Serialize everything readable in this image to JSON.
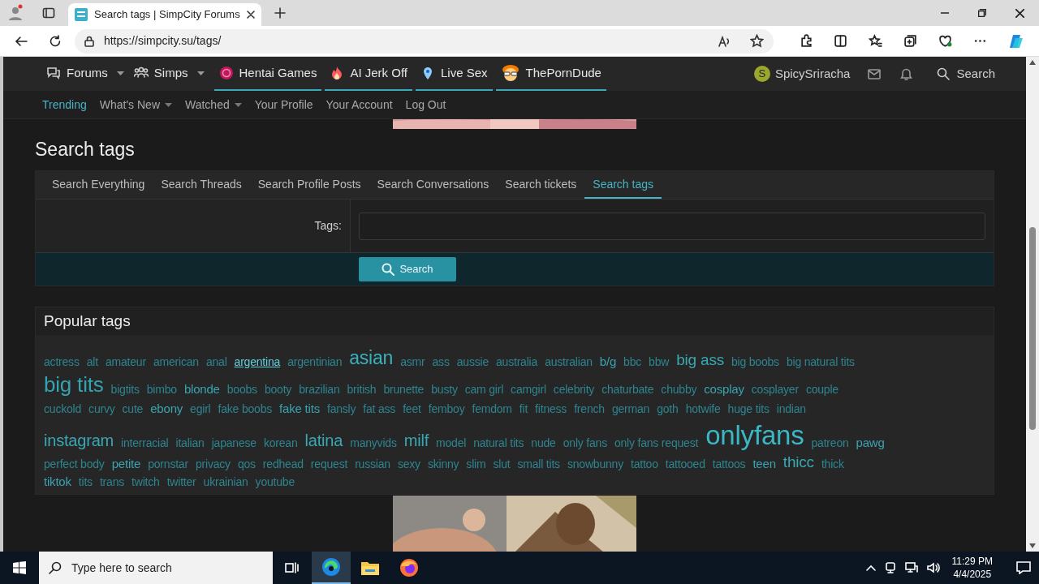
{
  "browser": {
    "tab_title": "Search tags | SimpCity Forums",
    "url": "https://simpcity.su/tags/"
  },
  "site_nav": {
    "items": [
      {
        "label": "Forums",
        "has_menu": true,
        "promoted": false
      },
      {
        "label": "Simps",
        "has_menu": true,
        "promoted": false
      },
      {
        "label": "Hentai Games",
        "has_menu": false,
        "promoted": true
      },
      {
        "label": "AI Jerk Off",
        "has_menu": false,
        "promoted": true
      },
      {
        "label": "Live Sex",
        "has_menu": false,
        "promoted": true
      },
      {
        "label": "ThePornDude",
        "has_menu": false,
        "promoted": true
      }
    ],
    "user": {
      "avatar_letter": "S",
      "name": "SpicySriracha"
    },
    "search": "Search"
  },
  "sub_nav": [
    {
      "label": "Trending",
      "selected": true,
      "has_menu": false
    },
    {
      "label": "What's New",
      "selected": false,
      "has_menu": true
    },
    {
      "label": "Watched",
      "selected": false,
      "has_menu": true
    },
    {
      "label": "Your Profile",
      "selected": false,
      "has_menu": false
    },
    {
      "label": "Your Account",
      "selected": false,
      "has_menu": false
    },
    {
      "label": "Log Out",
      "selected": false,
      "has_menu": false
    }
  ],
  "heading": "Search tags",
  "search_tabs": [
    {
      "label": "Search Everything",
      "selected": false
    },
    {
      "label": "Search Threads",
      "selected": false
    },
    {
      "label": "Search Profile Posts",
      "selected": false
    },
    {
      "label": "Search Conversations",
      "selected": false
    },
    {
      "label": "Search tickets",
      "selected": false
    },
    {
      "label": "Search tags",
      "selected": true
    }
  ],
  "form": {
    "label": "Tags:",
    "button": "Search"
  },
  "popular_tags": {
    "title": "Popular tags",
    "lines": [
      [
        {
          "t": "actress",
          "kind": "xs",
          "hovered": false
        },
        {
          "t": "alt",
          "kind": "xs",
          "hovered": false
        },
        {
          "t": "amateur",
          "kind": "xs",
          "hovered": false
        },
        {
          "t": "american",
          "kind": "xs",
          "hovered": false
        },
        {
          "t": "anal",
          "kind": "xs",
          "hovered": false
        },
        {
          "t": "argentina",
          "kind": "xs",
          "hovered": true
        },
        {
          "t": "argentinian",
          "kind": "xs",
          "hovered": false
        },
        {
          "t": "asian",
          "kind": "xl",
          "hovered": false
        },
        {
          "t": "asmr",
          "kind": "xs",
          "hovered": false
        },
        {
          "t": "ass",
          "kind": "xs",
          "hovered": false
        },
        {
          "t": "aussie",
          "kind": "xs",
          "hovered": false
        },
        {
          "t": "australia",
          "kind": "xs",
          "hovered": false
        },
        {
          "t": "australian",
          "kind": "xs",
          "hovered": false
        },
        {
          "t": "b/g",
          "kind": "s",
          "hovered": false
        },
        {
          "t": "bbc",
          "kind": "xs",
          "hovered": false
        },
        {
          "t": "bbw",
          "kind": "xs",
          "hovered": false
        },
        {
          "t": "big ass",
          "kind": "m",
          "hovered": false
        },
        {
          "t": "big boobs",
          "kind": "xs",
          "hovered": false
        },
        {
          "t": "big natural tits",
          "kind": "xs",
          "hovered": false
        }
      ],
      [
        {
          "t": "big tits",
          "kind": "xxl",
          "hovered": false
        },
        {
          "t": "bigtits",
          "kind": "xs",
          "hovered": false
        },
        {
          "t": "bimbo",
          "kind": "xs",
          "hovered": false
        },
        {
          "t": "blonde",
          "kind": "s",
          "hovered": false
        },
        {
          "t": "boobs",
          "kind": "xs",
          "hovered": false
        },
        {
          "t": "booty",
          "kind": "xs",
          "hovered": false
        },
        {
          "t": "brazilian",
          "kind": "xs",
          "hovered": false
        },
        {
          "t": "british",
          "kind": "xs",
          "hovered": false
        },
        {
          "t": "brunette",
          "kind": "xs",
          "hovered": false
        },
        {
          "t": "busty",
          "kind": "xs",
          "hovered": false
        },
        {
          "t": "cam girl",
          "kind": "xs",
          "hovered": false
        },
        {
          "t": "camgirl",
          "kind": "xs",
          "hovered": false
        },
        {
          "t": "celebrity",
          "kind": "xs",
          "hovered": false
        },
        {
          "t": "chaturbate",
          "kind": "xs",
          "hovered": false
        },
        {
          "t": "chubby",
          "kind": "xs",
          "hovered": false
        },
        {
          "t": "cosplay",
          "kind": "s",
          "hovered": false
        },
        {
          "t": "cosplayer",
          "kind": "xs",
          "hovered": false
        },
        {
          "t": "couple",
          "kind": "xs",
          "hovered": false
        }
      ],
      [
        {
          "t": "cuckold",
          "kind": "xs",
          "hovered": false
        },
        {
          "t": "curvy",
          "kind": "xs",
          "hovered": false
        },
        {
          "t": "cute",
          "kind": "xs",
          "hovered": false
        },
        {
          "t": "ebony",
          "kind": "s",
          "hovered": false
        },
        {
          "t": "egirl",
          "kind": "xs",
          "hovered": false
        },
        {
          "t": "fake boobs",
          "kind": "xs",
          "hovered": false
        },
        {
          "t": "fake tits",
          "kind": "s",
          "hovered": false
        },
        {
          "t": "fansly",
          "kind": "xs",
          "hovered": false
        },
        {
          "t": "fat ass",
          "kind": "xs",
          "hovered": false
        },
        {
          "t": "feet",
          "kind": "xs",
          "hovered": false
        },
        {
          "t": "femboy",
          "kind": "xs",
          "hovered": false
        },
        {
          "t": "femdom",
          "kind": "xs",
          "hovered": false
        },
        {
          "t": "fit",
          "kind": "xs",
          "hovered": false
        },
        {
          "t": "fitness",
          "kind": "xs",
          "hovered": false
        },
        {
          "t": "french",
          "kind": "xs",
          "hovered": false
        },
        {
          "t": "german",
          "kind": "xs",
          "hovered": false
        },
        {
          "t": "goth",
          "kind": "xs",
          "hovered": false
        },
        {
          "t": "hotwife",
          "kind": "xs",
          "hovered": false
        },
        {
          "t": "huge tits",
          "kind": "xs",
          "hovered": false
        },
        {
          "t": "indian",
          "kind": "xs",
          "hovered": false
        }
      ],
      [
        {
          "t": "instagram",
          "kind": "l",
          "hovered": false
        },
        {
          "t": "interracial",
          "kind": "xs",
          "hovered": false
        },
        {
          "t": "italian",
          "kind": "xs",
          "hovered": false
        },
        {
          "t": "japanese",
          "kind": "xs",
          "hovered": false
        },
        {
          "t": "korean",
          "kind": "xs",
          "hovered": false
        },
        {
          "t": "latina",
          "kind": "l",
          "hovered": false
        },
        {
          "t": "manyvids",
          "kind": "xs",
          "hovered": false
        },
        {
          "t": "milf",
          "kind": "l",
          "hovered": false
        },
        {
          "t": "model",
          "kind": "xs",
          "hovered": false
        },
        {
          "t": "natural tits",
          "kind": "xs",
          "hovered": false
        },
        {
          "t": "nude",
          "kind": "xs",
          "hovered": false
        },
        {
          "t": "only fans",
          "kind": "xs",
          "hovered": false
        },
        {
          "t": "only fans request",
          "kind": "xs",
          "hovered": false
        },
        {
          "t": "onlyfans",
          "kind": "xxxl",
          "hovered": false
        },
        {
          "t": "patreon",
          "kind": "xs",
          "hovered": false
        },
        {
          "t": "pawg",
          "kind": "s",
          "hovered": false
        }
      ],
      [
        {
          "t": "perfect body",
          "kind": "xs",
          "hovered": false
        },
        {
          "t": "petite",
          "kind": "s",
          "hovered": false
        },
        {
          "t": "pornstar",
          "kind": "xs",
          "hovered": false
        },
        {
          "t": "privacy",
          "kind": "xs",
          "hovered": false
        },
        {
          "t": "qos",
          "kind": "xs",
          "hovered": false
        },
        {
          "t": "redhead",
          "kind": "xs",
          "hovered": false
        },
        {
          "t": "request",
          "kind": "xs",
          "hovered": false
        },
        {
          "t": "russian",
          "kind": "xs",
          "hovered": false
        },
        {
          "t": "sexy",
          "kind": "xs",
          "hovered": false
        },
        {
          "t": "skinny",
          "kind": "xs",
          "hovered": false
        },
        {
          "t": "slim",
          "kind": "xs",
          "hovered": false
        },
        {
          "t": "slut",
          "kind": "xs",
          "hovered": false
        },
        {
          "t": "small tits",
          "kind": "xs",
          "hovered": false
        },
        {
          "t": "snowbunny",
          "kind": "xs",
          "hovered": false
        },
        {
          "t": "tattoo",
          "kind": "xs",
          "hovered": false
        },
        {
          "t": "tattooed",
          "kind": "xs",
          "hovered": false
        },
        {
          "t": "tattoos",
          "kind": "xs",
          "hovered": false
        },
        {
          "t": "teen",
          "kind": "s",
          "hovered": false
        },
        {
          "t": "thicc",
          "kind": "m",
          "hovered": false
        },
        {
          "t": "thick",
          "kind": "xs",
          "hovered": false
        }
      ],
      [
        {
          "t": "tiktok",
          "kind": "s",
          "hovered": false
        },
        {
          "t": "tits",
          "kind": "xs",
          "hovered": false
        },
        {
          "t": "trans",
          "kind": "xs",
          "hovered": false
        },
        {
          "t": "twitch",
          "kind": "xs",
          "hovered": false
        },
        {
          "t": "twitter",
          "kind": "xs",
          "hovered": false
        },
        {
          "t": "ukrainian",
          "kind": "xs",
          "hovered": false
        },
        {
          "t": "youtube",
          "kind": "xs",
          "hovered": false
        }
      ]
    ]
  },
  "taskbar": {
    "search_placeholder": "Type here to search",
    "time": "11:29 PM",
    "date": "4/4/2025"
  }
}
